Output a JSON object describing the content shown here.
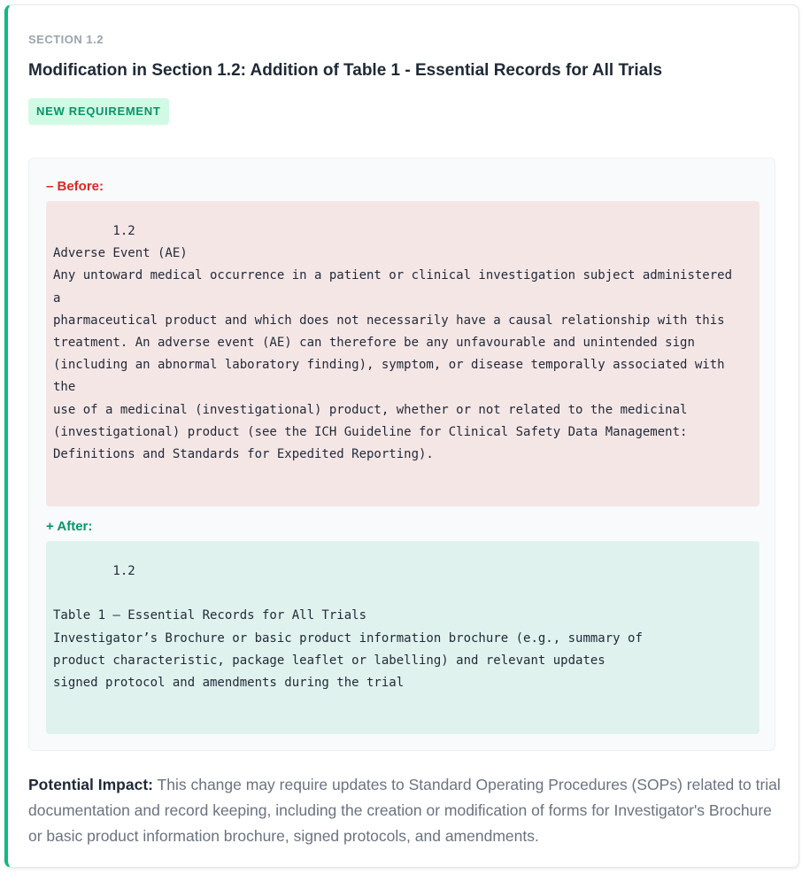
{
  "card": {
    "section_label": "SECTION 1.2",
    "title": "Modification in Section 1.2: Addition of Table 1 - Essential Records for All Trials",
    "badge": "NEW REQUIREMENT",
    "accent_color": "#10b981"
  },
  "diff": {
    "before_label": "– Before:",
    "before_text": "        1.2\nAdverse Event (AE)\nAny untoward medical occurrence in a patient or clinical investigation subject administered\na\npharmaceutical product and which does not necessarily have a causal relationship with this\ntreatment. An adverse event (AE) can therefore be any unfavourable and unintended sign\n(including an abnormal laboratory finding), symptom, or disease temporally associated with\nthe\nuse of a medicinal (investigational) product, whether or not related to the medicinal\n(investigational) product (see the ICH Guideline for Clinical Safety Data Management:\nDefinitions and Standards for Expedited Reporting).",
    "after_label": "+ After:",
    "after_text": "        1.2\n\nTable 1 – Essential Records for All Trials\nInvestigator’s Brochure or basic product information brochure (e.g., summary of\nproduct characteristic, package leaflet or labelling) and relevant updates\nsigned protocol and amendments during the trial",
    "before_color": "#dc2626",
    "after_color": "#059669"
  },
  "impact": {
    "label": "Potential Impact:",
    "text": " This change may require updates to Standard Operating Procedures (SOPs) related to trial documentation and record keeping, including the creation or modification of forms for Investigator's Brochure or basic product information brochure, signed protocols, and amendments."
  }
}
